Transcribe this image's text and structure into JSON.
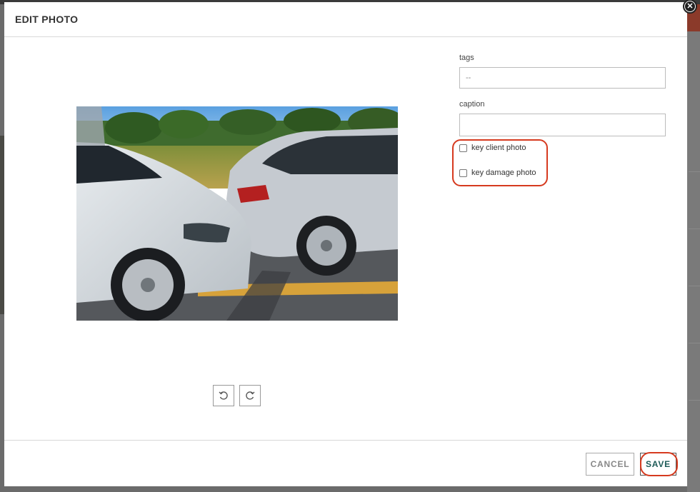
{
  "modal": {
    "title": "EDIT PHOTO",
    "close_icon": "close-icon"
  },
  "photo": {
    "alt": "Two white sedans in a rear-end collision on a roadside"
  },
  "form": {
    "tags_label": "tags",
    "tags_value": "--",
    "caption_label": "caption",
    "caption_value": "",
    "key_client_label": "key client photo",
    "key_client_checked": false,
    "key_damage_label": "key damage photo",
    "key_damage_checked": false
  },
  "controls": {
    "rotate_left_icon": "rotate-left-icon",
    "rotate_right_icon": "rotate-right-icon"
  },
  "footer": {
    "cancel_label": "CANCEL",
    "save_label": "SAVE"
  },
  "colors": {
    "highlight": "#d63a1f",
    "save_text": "#1d5a57"
  }
}
